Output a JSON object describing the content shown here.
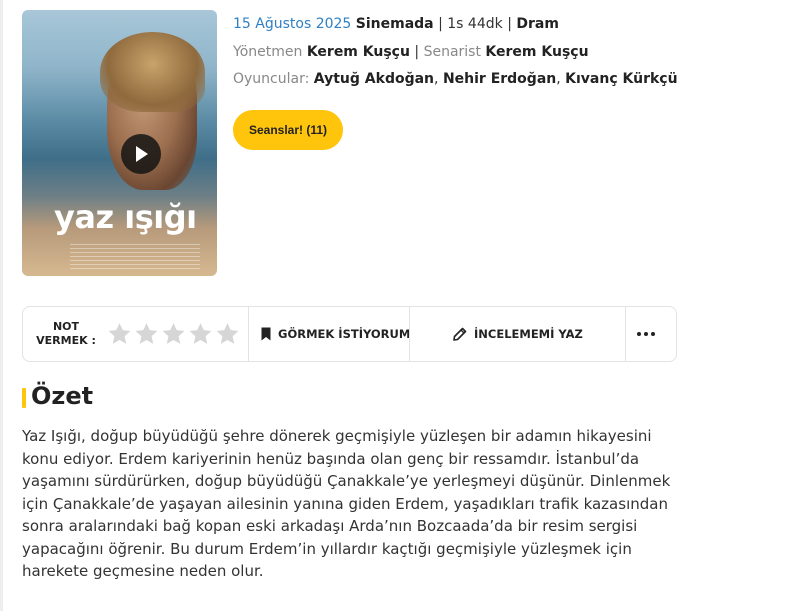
{
  "poster": {
    "title_art": "yaz ışığı"
  },
  "movie": {
    "release_date": "15 Ağustos 2025",
    "status": "Sinemada",
    "duration": "1s 44dk",
    "genre": "Dram",
    "director_label": "Yönetmen",
    "director": "Kerem Kuşçu",
    "writer_label": "Senarist",
    "writer": "Kerem Kuşçu",
    "cast_label": "Oyuncular:",
    "cast": [
      "Aytuğ Akdoğan",
      "Nehir Erdoğan",
      "Kıvanç Kürkçü"
    ],
    "separator": "|",
    "comma": ","
  },
  "seanslar_button": "Seanslar! (11)",
  "actions": {
    "rate_label_line1": "NOT",
    "rate_label_line2": "VERMEK :",
    "star_count": 5,
    "star_color": "#d6d6d6",
    "watchlist_label": "GÖRMEK İSTİYORUM",
    "review_label": "İNCELEMEMİ YAZ"
  },
  "summary": {
    "heading": "Özet",
    "text": "Yaz Işığı, doğup büyüdüğü şehre dönerek geçmişiyle yüzleşen bir adamın hikayesini konu ediyor. Erdem kariyerinin henüz başında olan genç bir ressamdır. İstanbul’da yaşamını sürdürürken, doğup büyüdüğü Çanakkale’ye yerleşmeyi düşünür. Dinlenmek için Çanakkale’de yaşayan ailesinin yanına giden Erdem, yaşadıkları trafik kazasından sonra aralarındaki bağ kopan eski arkadaşı Arda’nın Bozcaada’da bir resim sergisi yapacağını öğrenir. Bu durum Erdem’in yıllardır kaçtığı geçmişiyle yüzleşmek için harekete geçmesine neden olur."
  },
  "colors": {
    "accent": "#ffc40c",
    "link_blue": "#2f7fc4",
    "muted": "#888888"
  }
}
